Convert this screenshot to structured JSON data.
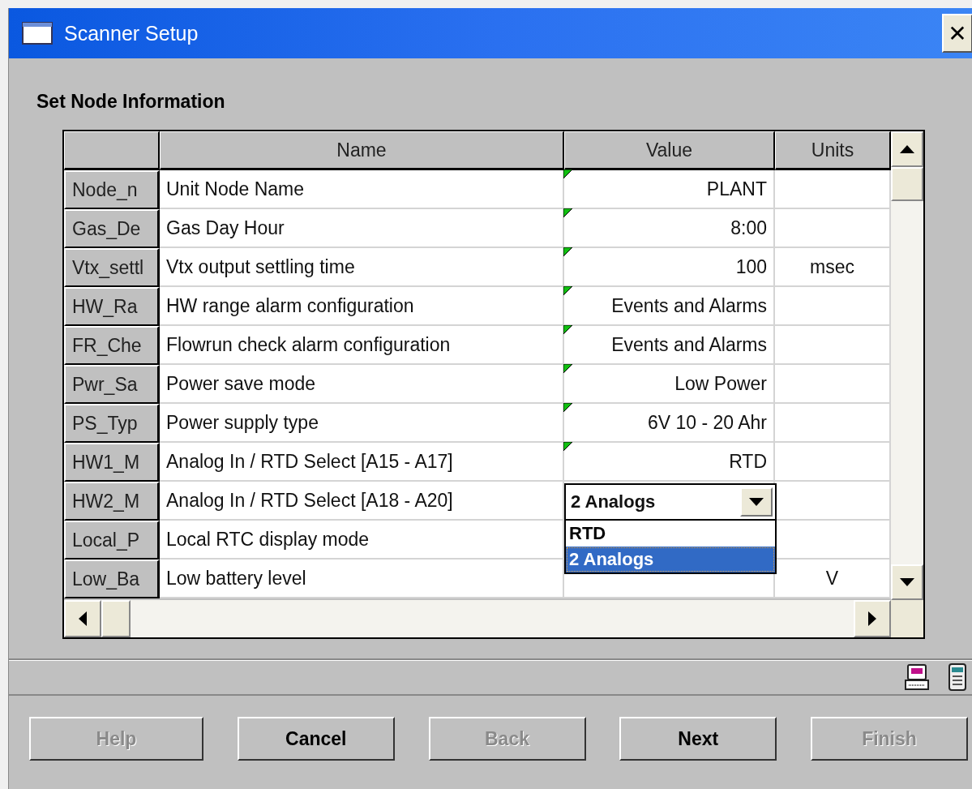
{
  "window": {
    "title": "Scanner Setup",
    "close": "✕"
  },
  "heading": "Set Node Information",
  "table": {
    "columns": [
      "Name",
      "Value",
      "Units"
    ],
    "rows": [
      {
        "key": "Node_n",
        "name": "Unit Node Name",
        "value": "PLANT",
        "marked": true
      },
      {
        "key": "Gas_De",
        "name": "Gas Day Hour",
        "value": "8:00",
        "marked": true
      },
      {
        "key": "Vtx_settl",
        "name": "Vtx output settling time",
        "value": "100",
        "units": "msec",
        "marked": true
      },
      {
        "key": "HW_Ra",
        "name": "HW range alarm configuration",
        "value": "Events and Alarms",
        "marked": true
      },
      {
        "key": "FR_Che",
        "name": "Flowrun check alarm configuration",
        "value": "Events and Alarms",
        "marked": true
      },
      {
        "key": "Pwr_Sa",
        "name": "Power save mode",
        "value": "Low Power",
        "marked": true
      },
      {
        "key": "PS_Typ",
        "name": "Power supply type",
        "value": "6V  10 - 20 Ahr",
        "marked": true
      },
      {
        "key": "HW1_M",
        "name": "Analog In / RTD Select [A15 - A17]",
        "value": "RTD",
        "marked": true
      },
      {
        "key": "HW2_M",
        "name": "Analog In / RTD Select [A18 - A20]",
        "editor": {
          "value": "2 Analogs",
          "options": [
            {
              "label": "RTD",
              "selected": false
            },
            {
              "label": "2 Analogs",
              "selected": true
            }
          ]
        }
      },
      {
        "key": "Local_P",
        "name": "Local RTC display mode"
      },
      {
        "key": "Low_Ba",
        "name": "Low battery level",
        "units": "V"
      }
    ]
  },
  "buttons": [
    {
      "label": "Help",
      "disabled": true
    },
    {
      "label": "Cancel",
      "disabled": false
    },
    {
      "label": "Back",
      "disabled": true
    },
    {
      "label": "Next",
      "disabled": false
    },
    {
      "label": "Finish",
      "disabled": true
    }
  ]
}
